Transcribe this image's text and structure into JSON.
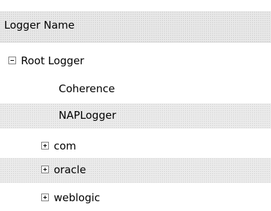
{
  "header": {
    "column_title": "Logger Name"
  },
  "tree": {
    "root": {
      "label": "Root Logger",
      "state": "expanded"
    },
    "children": [
      {
        "label": "Coherence",
        "state": "leaf"
      },
      {
        "label": "NAPLogger",
        "state": "leaf"
      },
      {
        "label": "com",
        "state": "collapsed"
      },
      {
        "label": "oracle",
        "state": "collapsed"
      },
      {
        "label": "weblogic",
        "state": "collapsed"
      }
    ]
  }
}
